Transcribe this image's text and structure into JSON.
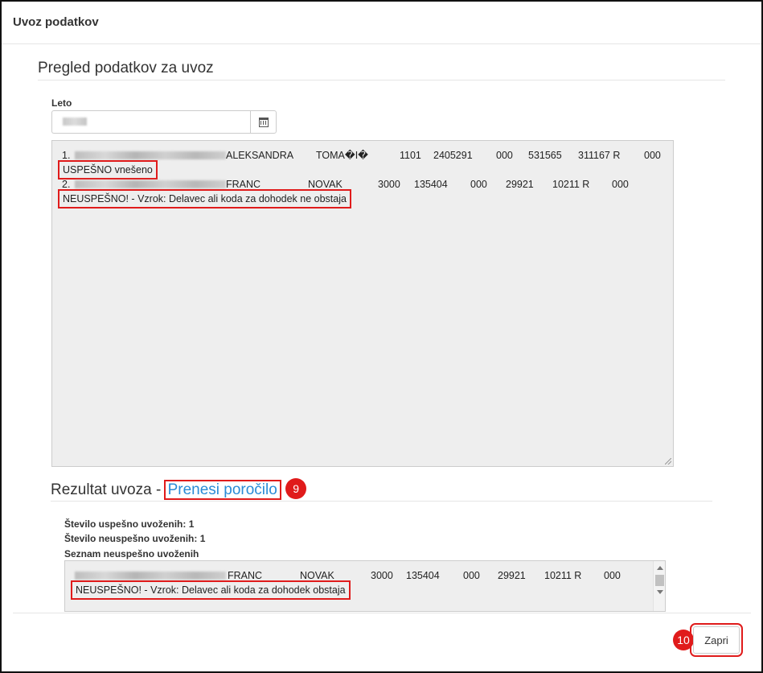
{
  "modal": {
    "title": "Uvoz podatkov",
    "preview_heading": "Pregled podatkov za uvoz",
    "year_label": "Leto",
    "calendar_icon": "calendar-icon"
  },
  "log": {
    "rows": [
      {
        "index": "1.",
        "first_name": "ALEKSANDRA",
        "last_name": "TOMA�I�",
        "c1": "1101",
        "c2": "2405291",
        "c3": "000",
        "c4": "531565",
        "c5": "311167 R",
        "c6": "000",
        "status": "USPEŠNO vnešeno"
      },
      {
        "index": "2.",
        "first_name": "FRANC",
        "last_name": "NOVAK",
        "c1": "3000",
        "c2": "135404",
        "c3": "000",
        "c4": "29921",
        "c5": "10211 R",
        "c6": "000",
        "status": "NEUSPEŠNO! - Vzrok: Delavec ali koda za dohodek ne obstaja"
      }
    ]
  },
  "result": {
    "heading": "Rezultat uvoza -",
    "download_link": "Prenesi poročilo",
    "badge_link": "9",
    "success_count": "Število uspešno uvoženih: 1",
    "fail_count": "Število neuspešno uvoženih: 1",
    "fail_list_label": "Seznam neuspešno uvoženih",
    "fail_row": {
      "first_name": "FRANC",
      "last_name": "NOVAK",
      "c1": "3000",
      "c2": "135404",
      "c3": "000",
      "c4": "29921",
      "c5": "10211 R",
      "c6": "000",
      "status": "NEUSPEŠNO! - Vzrok: Delavec ali koda za dohodek obstaja"
    }
  },
  "footer": {
    "close_label": "Zapri",
    "badge_close": "10"
  },
  "colors": {
    "highlight": "#e01b1b",
    "link": "#2a8bd6",
    "textarea_bg": "#eeeeee"
  }
}
